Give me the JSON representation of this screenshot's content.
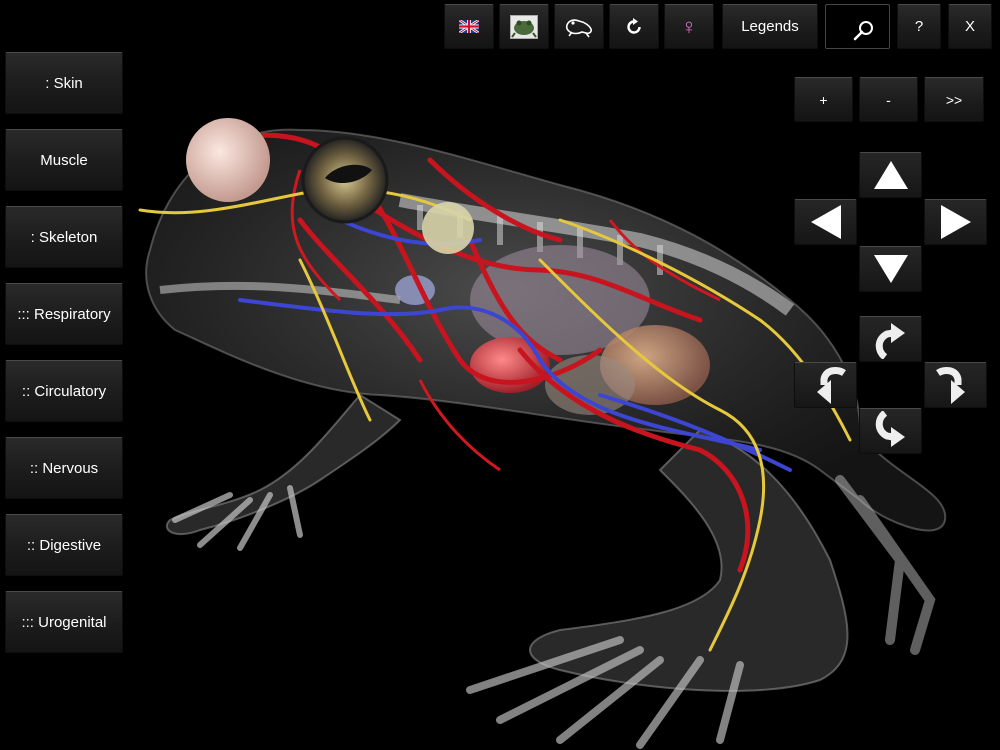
{
  "toolbar": {
    "language_icon": "uk-flag-icon",
    "frog_photo_icon": "frog-photo-icon",
    "frog_outline_icon": "frog-outline-icon",
    "reset_icon": "reset-rotate-icon",
    "sex_label": "♀",
    "legends_label": "Legends",
    "search_icon": "search-icon",
    "help_label": "?",
    "close_label": "X"
  },
  "zoom": {
    "in_label": "+",
    "out_label": "-",
    "next_label": ">>"
  },
  "systems": {
    "items": [
      {
        "label": ": Skin"
      },
      {
        "label": "Muscle"
      },
      {
        "label": ": Skeleton"
      },
      {
        "label": "::: Respiratory"
      },
      {
        "label": ":: Circulatory"
      },
      {
        "label": ":: Nervous"
      },
      {
        "label": ":: Digestive"
      },
      {
        "label": "::: Urogenital"
      }
    ]
  },
  "navigation": {
    "pan": [
      "arrow-up-icon",
      "arrow-left-icon",
      "arrow-right-icon",
      "arrow-down-icon"
    ],
    "rotate": [
      "rotate-up-icon",
      "rotate-left-icon",
      "rotate-right-icon",
      "rotate-down-icon"
    ]
  },
  "colors": {
    "background": "#000000",
    "arteries": "#c8141e",
    "veins": "#3c46d2",
    "nerves": "#e6c83c",
    "skeleton": "#d2d2d2"
  }
}
